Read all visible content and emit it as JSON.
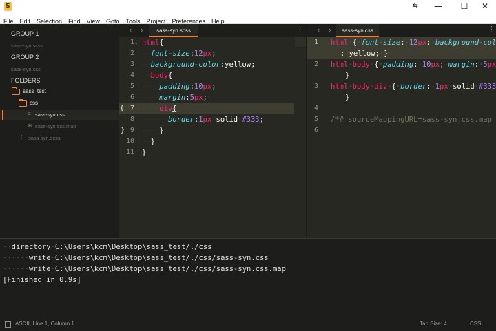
{
  "window": {
    "minimize": "—",
    "maximize": "☐",
    "close": "✕",
    "pin": "⇆"
  },
  "menu": [
    "File",
    "Edit",
    "Selection",
    "Find",
    "View",
    "Goto",
    "Tools",
    "Project",
    "Preferences",
    "Help"
  ],
  "sidebar": {
    "group1": "GROUP 1",
    "group1_file": "sass-syn.scss",
    "group2": "GROUP 2",
    "group2_file": "sass-syn.css",
    "folders_label": "FOLDERS",
    "folder_root": "sass_test",
    "folder_css": "css",
    "file_css": "sass-syn.css",
    "file_map": "sass-syn.css.map",
    "file_scss": "sass-syn.scss"
  },
  "left_pane": {
    "tab_label": "sass-syn.scss",
    "line_numbers": [
      "1",
      "2",
      "3",
      "4",
      "5",
      "6",
      "7",
      "8",
      "9",
      "10",
      "11"
    ],
    "code": {
      "l1_tag": "html",
      "l1_brace": "{",
      "l2_prop": "font-size",
      "l2_colon": ":",
      "l2_num": "12",
      "l2_unit": "px",
      "l2_semi": ";",
      "l3_prop": "background-color",
      "l3_colon": ":",
      "l3_val": "yellow",
      "l3_semi": ";",
      "l4_tag": "body",
      "l4_brace": "{",
      "l5_prop": "padding",
      "l5_colon": ":",
      "l5_num": "10",
      "l5_unit": "px",
      "l5_semi": ";",
      "l6_prop": "margin",
      "l6_colon": ":",
      "l6_num": "5",
      "l6_unit": "px",
      "l6_semi": ";",
      "l7_tag": "div",
      "l7_brace": "{",
      "l8_prop": "border",
      "l8_colon": ":",
      "l8_num": "1",
      "l8_unit": "px",
      "l8_solid": "solid",
      "l8_hash": "#333",
      "l8_semi": ";",
      "l9_brace": "}",
      "l10_brace": "}",
      "l11_brace": "}",
      "bracket_open_marker": "{",
      "bracket_close_marker": "}"
    }
  },
  "right_pane": {
    "tab_label": "sass-syn.css",
    "line_numbers": [
      "1",
      "2",
      "3",
      "4",
      "5",
      "6"
    ],
    "code": {
      "l1_sel": "html",
      "l1_open": "{",
      "l1_prop1": "font-size",
      "l1_num": "12",
      "l1_unit": "px",
      "l1_prop2": "background-color",
      "l1b_val": "yellow",
      "l1b_close": "}",
      "l2_sel1": "html",
      "l2_sel2": "body",
      "l2_open": "{",
      "l2_prop1": "padding",
      "l2_num1": "10",
      "l2_unit1": "px",
      "l2_prop2": "margin",
      "l2_num2": "5",
      "l2_unit2": "px",
      "l2b_close": "}",
      "l3_sel1": "html",
      "l3_sel2": "body",
      "l3_sel3": "div",
      "l3_open": "{",
      "l3_prop": "border",
      "l3_num": "1",
      "l3_unit": "px",
      "l3_solid": "solid",
      "l3_hash": "#333",
      "l3b_close": "}",
      "l5_comment": "/*# sourceMappingURL=sass-syn.css.map */"
    }
  },
  "console": {
    "line1_label": "directory",
    "line1_path": "C:\\Users\\kcm\\Desktop\\sass_test/./css",
    "line2_label": "write",
    "line2_path": "C:\\Users\\kcm\\Desktop\\sass_test/./css/sass-syn.css",
    "line3_label": "write",
    "line3_path": "C:\\Users\\kcm\\Desktop\\sass_test/./css/sass-syn.css.map",
    "line4": "[Finished in 0.9s]"
  },
  "status": {
    "position": "ASCII, Line 1, Column 1",
    "tab_size": "Tab Size: 4",
    "syntax": "CSS"
  }
}
